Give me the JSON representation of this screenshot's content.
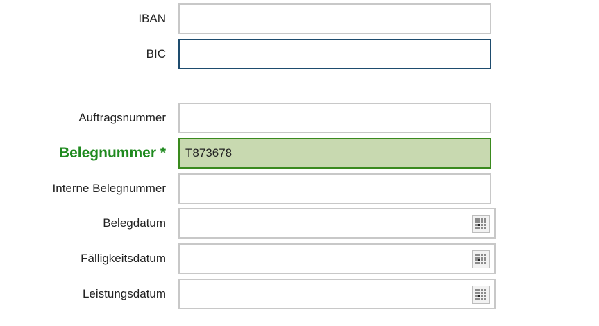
{
  "form": {
    "iban": {
      "label": "IBAN",
      "value": ""
    },
    "bic": {
      "label": "BIC",
      "value": ""
    },
    "auftragsnummer": {
      "label": "Auftragsnummer",
      "value": ""
    },
    "belegnummer": {
      "label": "Belegnummer *",
      "value": "T873678"
    },
    "interne_belegnummer": {
      "label": "Interne Belegnummer",
      "value": ""
    },
    "belegdatum": {
      "label": "Belegdatum",
      "value": ""
    },
    "faelligkeitsdatum": {
      "label": "Fälligkeitsdatum",
      "value": ""
    },
    "leistungsdatum": {
      "label": "Leistungsdatum",
      "value": ""
    }
  },
  "icons": {
    "date_picker": "calendar-icon"
  },
  "colors": {
    "required_label": "#1f8a1f",
    "filled_field_background": "#c8d9b0",
    "filled_field_border": "#3a8a1e",
    "focused_field_border": "#1e4c6e"
  }
}
